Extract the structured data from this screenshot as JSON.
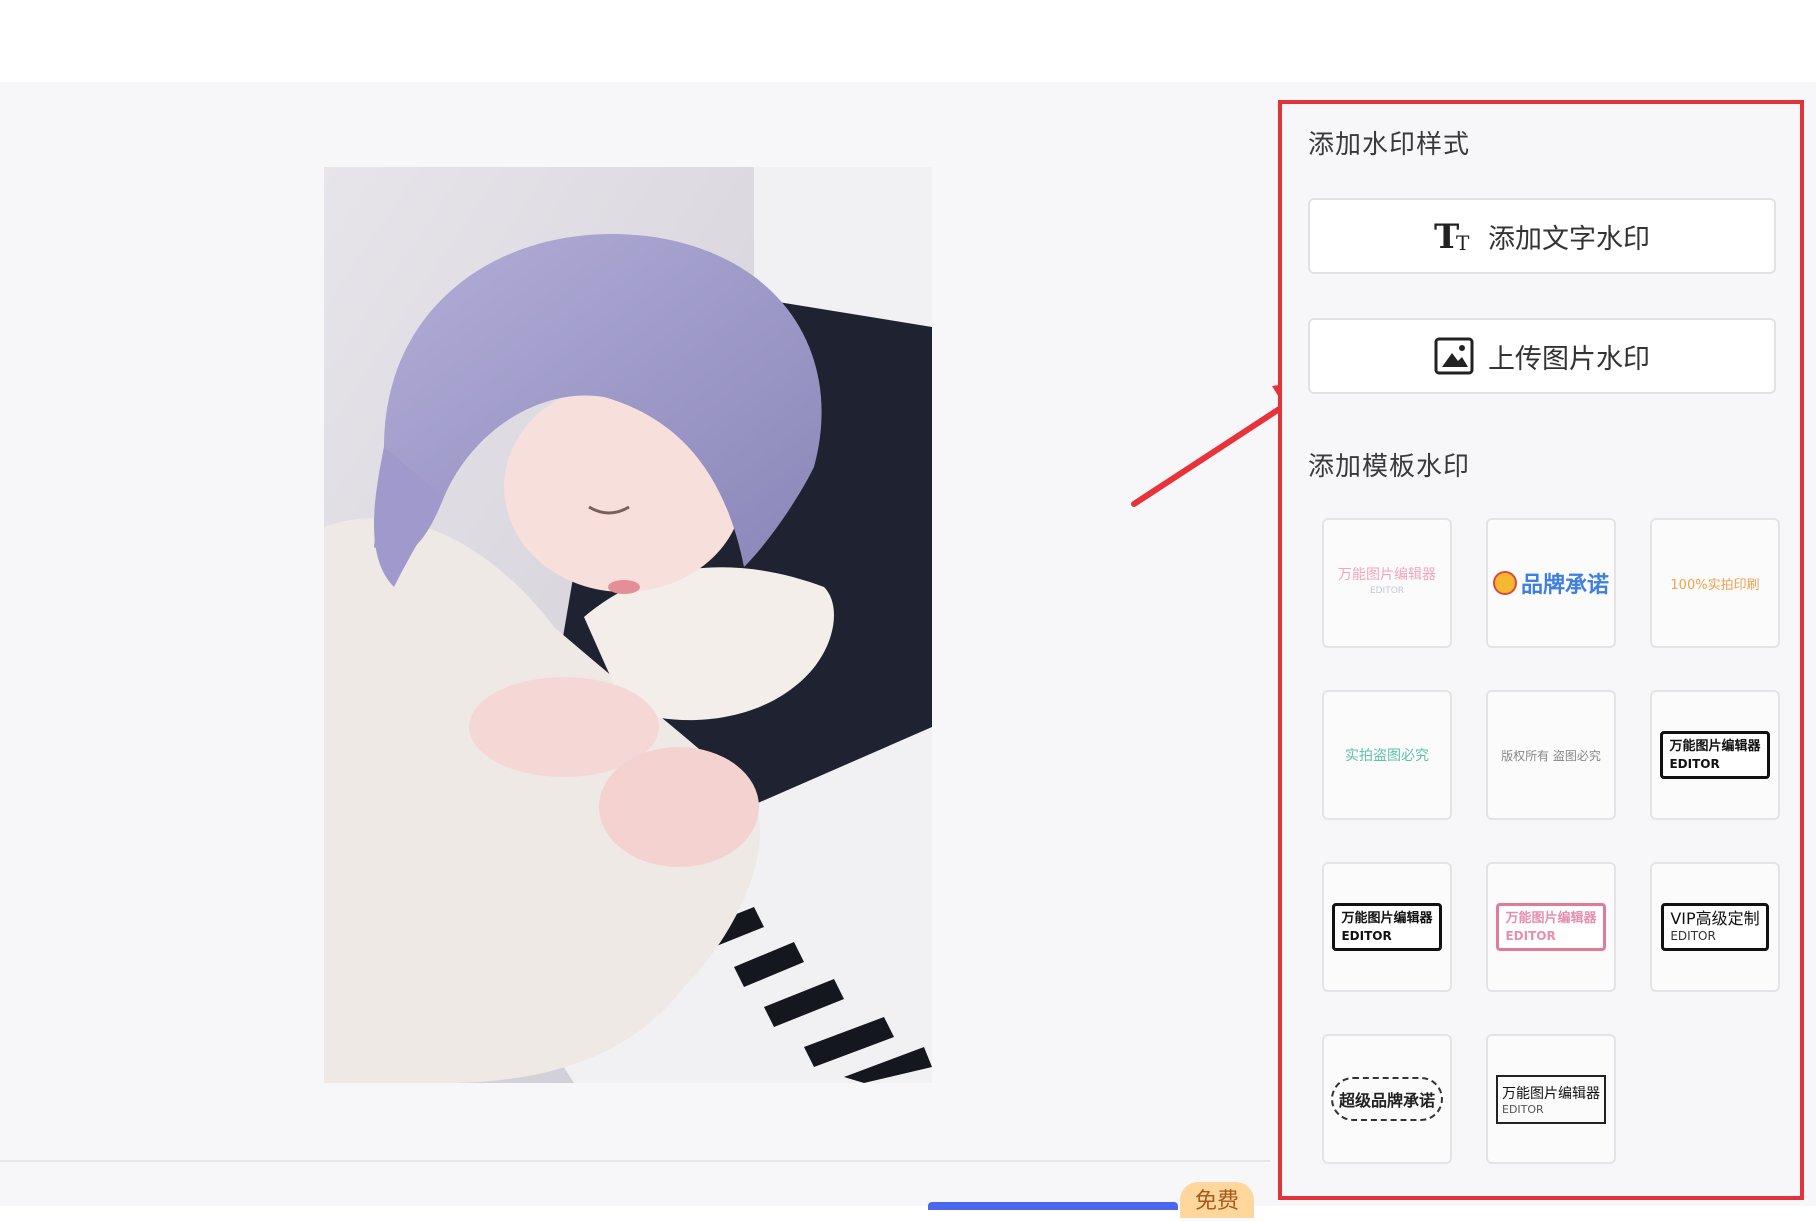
{
  "sidebar": {
    "style_section_title": "添加水印样式",
    "text_watermark_button": "添加文字水印",
    "image_watermark_button": "上传图片水印",
    "template_section_title": "添加模板水印",
    "templates": [
      {
        "line1": "万能图片编辑器",
        "line2": "EDITOR"
      },
      {
        "line1": "品牌承诺",
        "line2": ""
      },
      {
        "line1": "100%实拍印刷",
        "line2": ""
      },
      {
        "line1": "实拍盗图必究",
        "line2": ""
      },
      {
        "line1": "版权所有 盗图必究",
        "line2": ""
      },
      {
        "line1": "万能图片编辑器",
        "line2": "EDITOR"
      },
      {
        "line1": "万能图片编辑器",
        "line2": "EDITOR"
      },
      {
        "line1": "万能图片编辑器",
        "line2": "EDITOR"
      },
      {
        "line1": "VIP高级定制",
        "line2": "EDITOR"
      },
      {
        "line1": "超级品牌承诺",
        "line2": ""
      },
      {
        "line1": "万能图片编辑器",
        "line2": "EDITOR"
      }
    ]
  },
  "footer": {
    "free_badge": "免费"
  },
  "colors": {
    "highlight_border": "#e0333a",
    "annotation_arrow": "#e8333a",
    "primary_button": "#4b67f0"
  },
  "icons": {
    "text_watermark": "text-size-icon",
    "image_watermark": "image-icon"
  }
}
